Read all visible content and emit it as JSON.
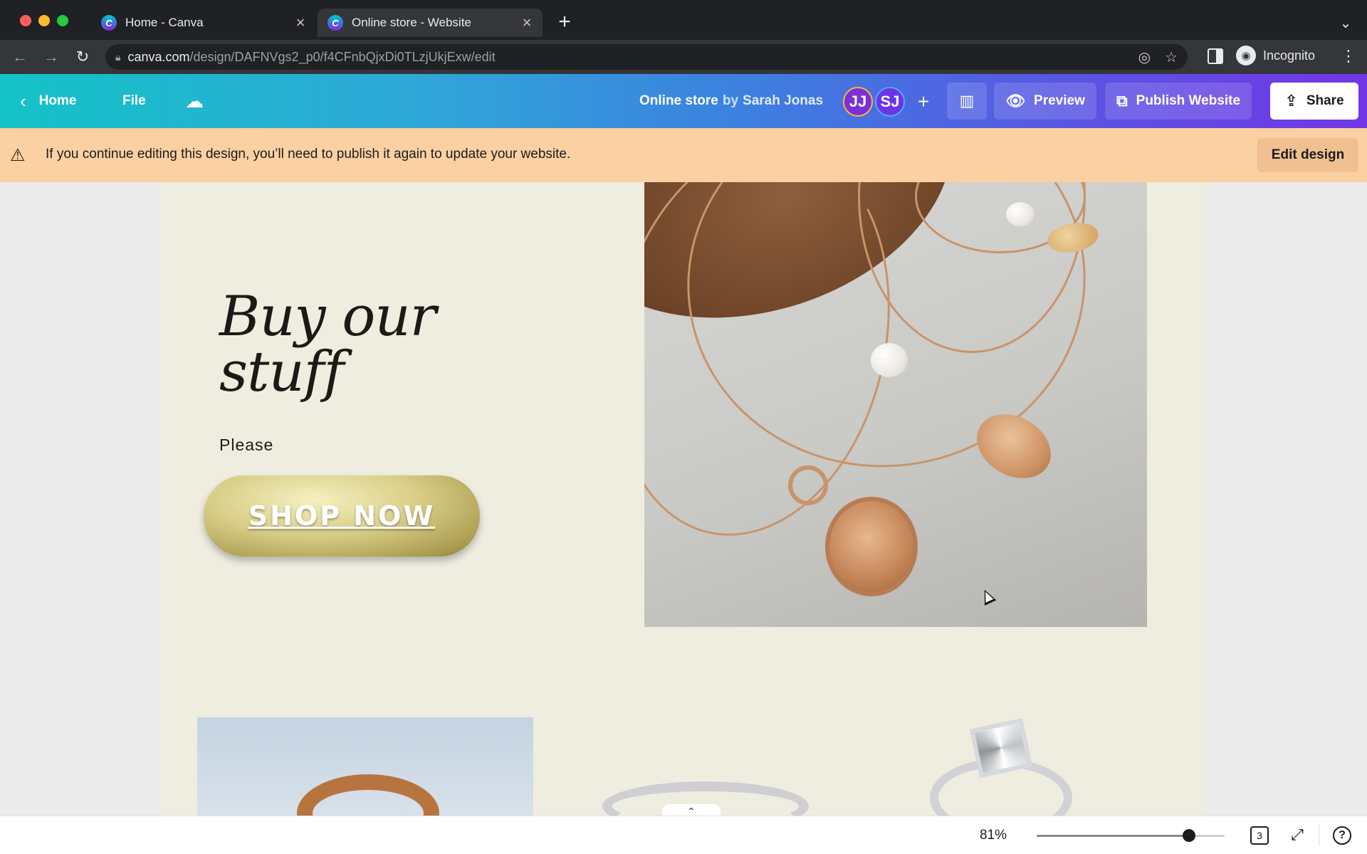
{
  "browser": {
    "tabs": [
      {
        "title": "Home - Canva",
        "active": false,
        "icon": "canva-favicon"
      },
      {
        "title": "Online store - Website",
        "active": true,
        "icon": "canva-favicon"
      }
    ],
    "url_domain": "canva.com",
    "url_path": "/design/DAFNVgs2_p0/f4CFnbQjxDi0TLzjUkjExw/edit",
    "profile_label": "Incognito"
  },
  "header": {
    "home_label": "Home",
    "file_label": "File",
    "doc_name": "Online store",
    "by_label": "by",
    "owner": "Sarah Jonas",
    "collaborators": [
      "JJ",
      "SJ"
    ],
    "preview_label": "Preview",
    "publish_label": "Publish Website",
    "share_label": "Share"
  },
  "banner": {
    "message": "If you continue editing this design, you’ll need to publish it again to update your website.",
    "button_label": "Edit design"
  },
  "design": {
    "headline_line1": "Buy our",
    "headline_line2": "stuff",
    "subtext": "Please",
    "cta_label": "SHOP NOW"
  },
  "footer": {
    "zoom": "81%",
    "zoom_fraction": 0.81,
    "page_count": "3"
  },
  "colors": {
    "header_gradient_start": "#14c3c7",
    "header_gradient_end": "#7336e6",
    "banner": "#fbd0a2",
    "page_background": "#efede0"
  }
}
